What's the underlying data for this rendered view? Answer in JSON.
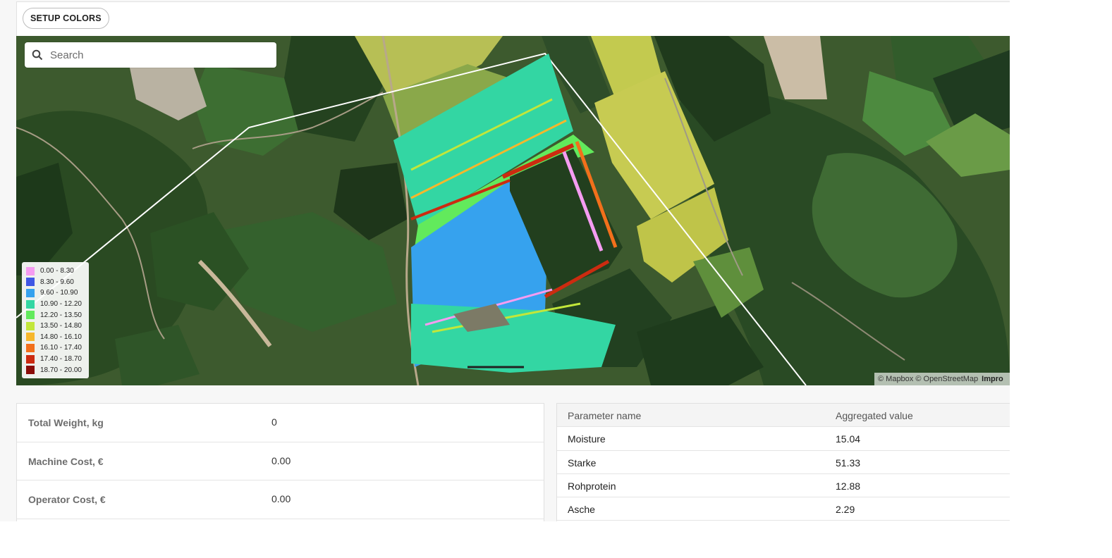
{
  "toolbar": {
    "setup_colors_label": "SETUP COLORS"
  },
  "search": {
    "placeholder": "Search",
    "icon": "search-icon"
  },
  "legend": {
    "items": [
      {
        "label": "0.00 - 8.30",
        "color": "#f59cf1"
      },
      {
        "label": "8.30 - 9.60",
        "color": "#3f57e4"
      },
      {
        "label": "9.60 - 10.90",
        "color": "#36a2ee"
      },
      {
        "label": "10.90 - 12.20",
        "color": "#33d6a3"
      },
      {
        "label": "12.20 - 13.50",
        "color": "#62ea5c"
      },
      {
        "label": "13.50 - 14.80",
        "color": "#c2e73a"
      },
      {
        "label": "14.80 - 16.10",
        "color": "#f6b72c"
      },
      {
        "label": "16.10 - 17.40",
        "color": "#f2701b"
      },
      {
        "label": "17.40 - 18.70",
        "color": "#cc2b10"
      },
      {
        "label": "18.70 - 20.00",
        "color": "#8a0c08"
      }
    ]
  },
  "map": {
    "attribution_text": "© Mapbox © OpenStreetMap",
    "attribution_link": "Impro"
  },
  "summary": {
    "rows": [
      {
        "label": "Total Weight, kg",
        "value": "0"
      },
      {
        "label": "Machine Cost, €",
        "value": "0.00"
      },
      {
        "label": "Operator Cost, €",
        "value": "0.00"
      }
    ]
  },
  "parameters": {
    "header": {
      "name": "Parameter name",
      "value": "Aggregated value"
    },
    "rows": [
      {
        "name": "Moisture",
        "value": "15.04"
      },
      {
        "name": "Starke",
        "value": "51.33"
      },
      {
        "name": "Rohprotein",
        "value": "12.88"
      },
      {
        "name": "Asche",
        "value": "2.29"
      }
    ]
  }
}
